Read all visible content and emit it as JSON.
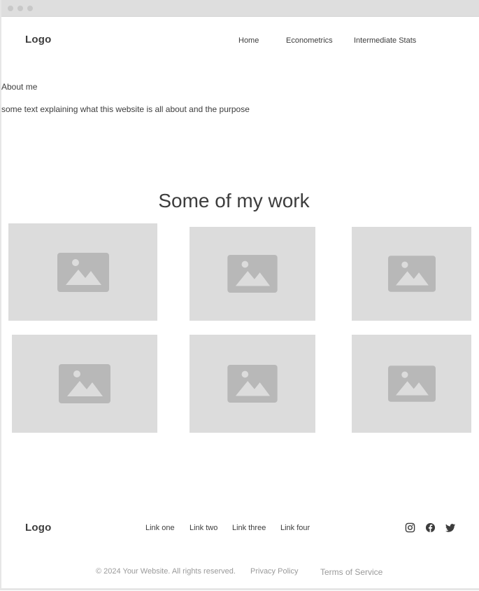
{
  "header": {
    "logo": "Logo",
    "nav": [
      {
        "label": "Home"
      },
      {
        "label": "Econometrics"
      },
      {
        "label": "Intermediate Stats"
      }
    ]
  },
  "about": {
    "heading": "About me",
    "text": "some text explaining what this website is all about and the purpose"
  },
  "work": {
    "title": "Some of my work",
    "items": [
      {
        "icon": "image-placeholder-icon"
      },
      {
        "icon": "image-placeholder-icon"
      },
      {
        "icon": "image-placeholder-icon"
      },
      {
        "icon": "image-placeholder-icon"
      },
      {
        "icon": "image-placeholder-icon"
      },
      {
        "icon": "image-placeholder-icon"
      }
    ]
  },
  "footer": {
    "logo": "Logo",
    "links": [
      {
        "label": "Link one"
      },
      {
        "label": "Link two"
      },
      {
        "label": "Link three"
      },
      {
        "label": "Link four"
      }
    ],
    "social": [
      "instagram-icon",
      "facebook-icon",
      "twitter-icon"
    ],
    "copyright": "© 2024 Your Website. All rights reserved.",
    "privacy": "Privacy Policy",
    "terms": "Terms of Service"
  },
  "colors": {
    "text": "#3d3d3d",
    "placeholder": "#dcdcdc",
    "placeholder_icon": "#b8b8b8",
    "muted": "#9a9a9a"
  }
}
